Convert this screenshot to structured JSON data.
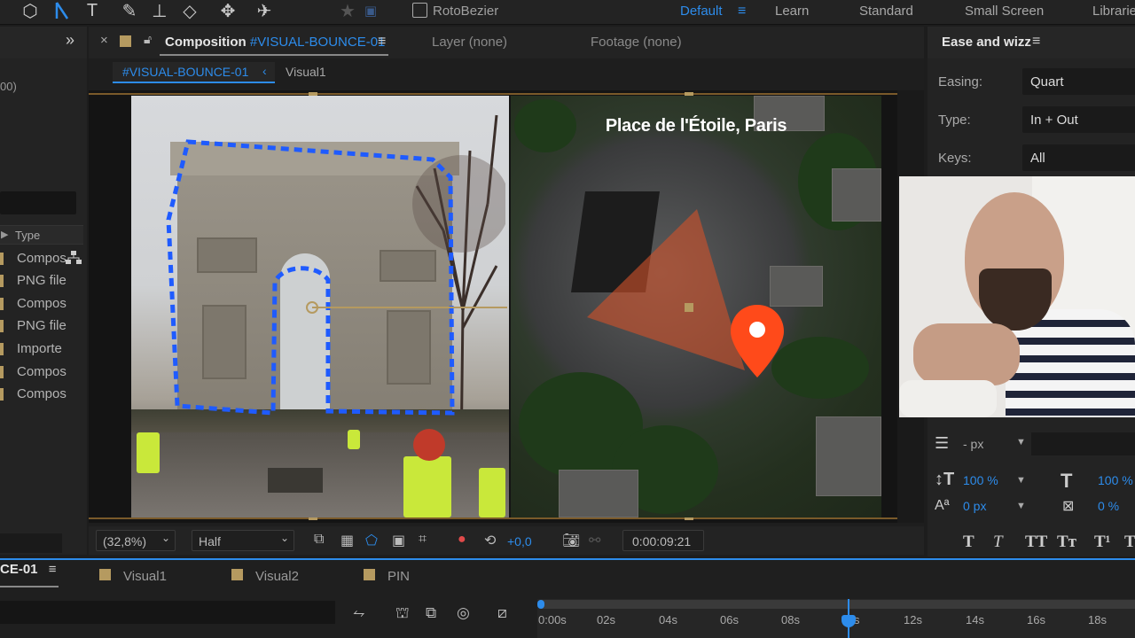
{
  "toolbar": {
    "roto_bezier_label": "RotoBezier",
    "workspaces": [
      "Default",
      "Learn",
      "Standard",
      "Small Screen",
      "Librarie"
    ],
    "active_workspace": "Default"
  },
  "project": {
    "partial_text": "00)",
    "type_header": "Type",
    "rows": [
      "Compos",
      "PNG file",
      "Compos",
      "PNG file",
      "Importe",
      "Compos",
      "Compos"
    ]
  },
  "composition": {
    "tab_prefix": "Composition",
    "tab_name": "#VISUAL-BOUNCE-01",
    "layer_tab": "Layer (none)",
    "footage_tab": "Footage (none)",
    "breadcrumb_active": "#VISUAL-BOUNCE-01",
    "breadcrumb_next": "Visual1",
    "map_title": "Place de l'Étoile, Paris"
  },
  "viewer_bar": {
    "zoom": "(32,8%)",
    "resolution": "Half",
    "exposure": "+0,0",
    "timecode": "0:00:09:21"
  },
  "ease_panel": {
    "title": "Ease and wizz",
    "easing_label": "Easing:",
    "easing_value": "Quart",
    "type_label": "Type:",
    "type_value": "In + Out",
    "keys_label": "Keys:",
    "keys_value": "All"
  },
  "character": {
    "leading": "- px",
    "vscale": "100 %",
    "baseline": "0 px",
    "hscale": "100 %",
    "tsume": "0 %"
  },
  "timeline": {
    "active_tab": "CE-01",
    "tabs": [
      "Visual1",
      "Visual2",
      "PIN"
    ],
    "ticks": [
      "0:00s",
      "02s",
      "04s",
      "06s",
      "08s",
      "s",
      "12s",
      "14s",
      "16s",
      "18s"
    ]
  },
  "colors": {
    "accent": "#2d8ceb",
    "label_swatch": "#b59a60",
    "mask_blue": "#1f5bff",
    "pin_red": "#ff4a1a"
  }
}
